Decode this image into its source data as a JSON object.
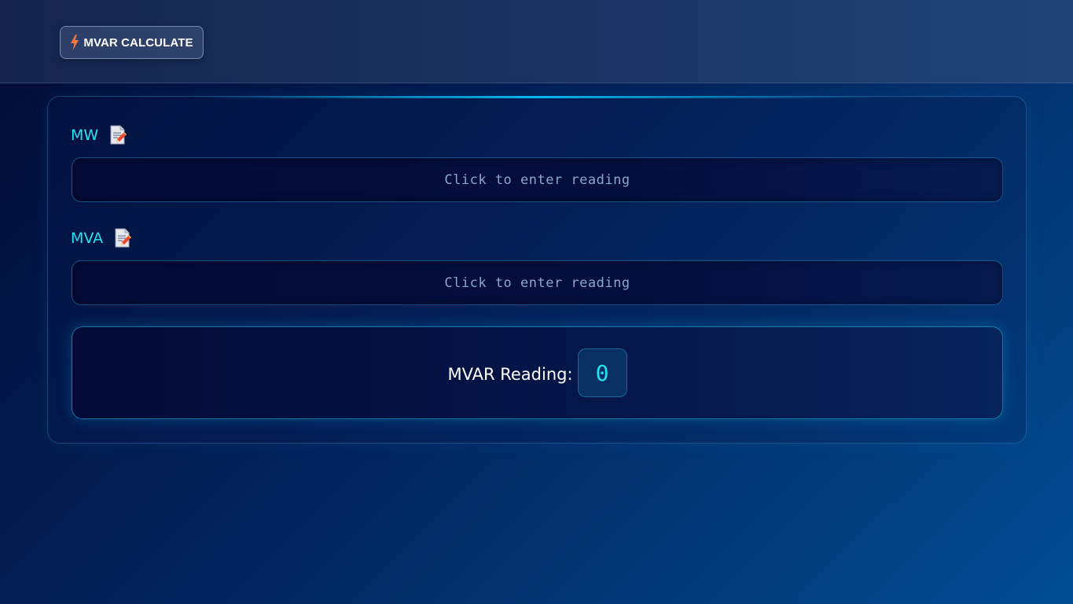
{
  "header": {
    "app_button_label": "MVAR CALCULATE",
    "app_button_icon": "lightning-bolt-icon"
  },
  "fields": {
    "mw": {
      "label": "MW",
      "icon": "edit-document-icon",
      "placeholder": "Click to enter reading"
    },
    "mva": {
      "label": "MVA",
      "icon": "edit-document-icon",
      "placeholder": "Click to enter reading"
    }
  },
  "result": {
    "label": "MVAR Reading:",
    "value": "0"
  },
  "colors": {
    "accent": "#22e4f2",
    "bolt": "#f5793a",
    "background_dark": "#020b33",
    "background_light": "#014d94"
  }
}
